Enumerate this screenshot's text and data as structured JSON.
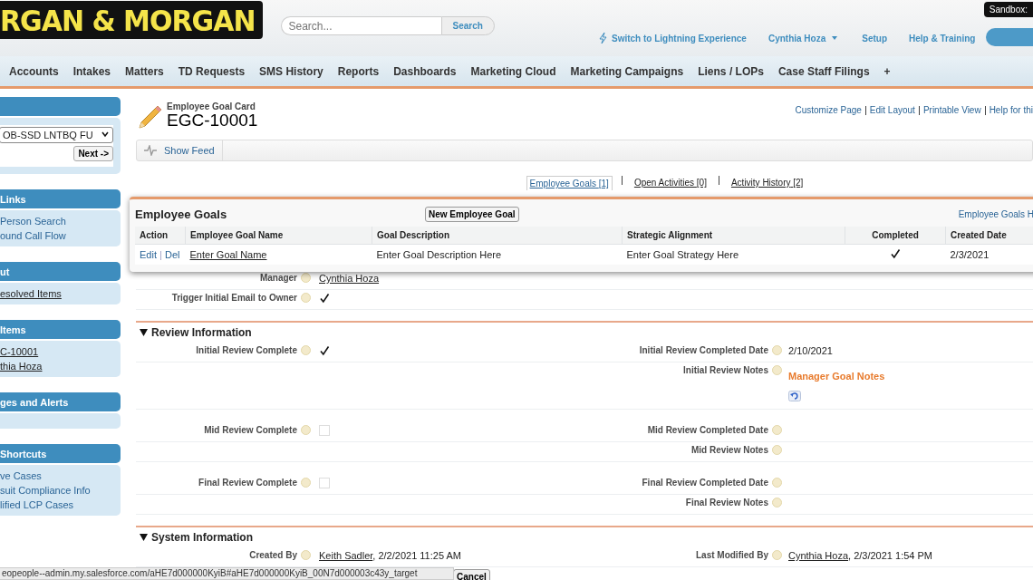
{
  "header": {
    "logo": "RGAN & MORGAN",
    "search_placeholder": "Search...",
    "search_button": "Search",
    "lightning_link": "Switch to Lightning Experience",
    "user_menu": "Cynthia Hoza",
    "links": [
      "Setup",
      "Help & Training"
    ],
    "sandbox_badge": "Sandbox:"
  },
  "nav_tabs": [
    "Accounts",
    "Intakes",
    "Matters",
    "TD Requests",
    "SMS History",
    "Reports",
    "Dashboards",
    "Marketing Cloud",
    "Marketing Campaigns",
    "Liens / LOPs",
    "Case Staff Filings",
    "+"
  ],
  "sidebar": [
    {
      "kind": "picker",
      "select_value": "OB-SSD LNTBQ FU",
      "button": "Next ->"
    },
    {
      "kind": "links",
      "title": "Links",
      "items": [
        "Person Search",
        "ound Call Flow"
      ]
    },
    {
      "kind": "recent",
      "title": "ut",
      "items": [
        "esolved Items"
      ]
    },
    {
      "kind": "recent",
      "title": "Items",
      "items": [
        "C-10001",
        "thia Hoza"
      ]
    },
    {
      "kind": "links",
      "title": "ges and Alerts"
    },
    {
      "kind": "links",
      "title": "Shortcuts",
      "items": [
        "ve Cases",
        "suit Compliance Info",
        "lified LCP Cases"
      ]
    }
  ],
  "record": {
    "type": "Employee Goal Card",
    "name": "EGC-10001",
    "links": [
      "Customize Page",
      "Edit Layout",
      "Printable View",
      "Help for thi"
    ]
  },
  "show_feed": "Show Feed",
  "related_tabs": [
    {
      "label": "Employee Goals",
      "count": "[1]",
      "selected": true
    },
    {
      "label": "Open Activities",
      "count": "[0]",
      "selected": false
    },
    {
      "label": "Activity History",
      "count": "[2]",
      "selected": false
    }
  ],
  "popup": {
    "title": "Employee Goals",
    "new_button": "New Employee Goal",
    "help_link": "Employee Goals H",
    "columns": [
      "Action",
      "Employee Goal Name",
      "Goal Description",
      "Strategic Alignment",
      "Completed",
      "Created Date"
    ],
    "rows": [
      {
        "actions": [
          "Edit",
          "Del"
        ],
        "name": "Enter Goal Name",
        "description": "Enter Goal Description Here",
        "strategy": "Enter Goal Strategy Here",
        "completed": true,
        "created": "2/3/2021"
      }
    ]
  },
  "top_fields": [
    {
      "label": "Manager",
      "kind": "link",
      "value": "Cynthia Hoza"
    },
    {
      "label": "Trigger Initial Email to Owner",
      "kind": "check",
      "checked": true
    }
  ],
  "sections": [
    {
      "title": "Review Information",
      "expanded": true,
      "groups": [
        [
          {
            "left": {
              "label": "Initial Review Complete",
              "kind": "check",
              "checked": true
            },
            "right": {
              "label": "Initial Review Completed Date",
              "kind": "text",
              "value": "2/10/2021"
            }
          },
          {
            "right": {
              "label": "Initial Review Notes",
              "kind": "notes",
              "value": "Manager Goal Notes"
            }
          }
        ],
        [
          {
            "left": {
              "label": "Mid Review Complete",
              "kind": "check",
              "checked": false
            },
            "right": {
              "label": "Mid Review Completed Date",
              "kind": "text"
            }
          },
          {
            "right": {
              "label": "Mid Review Notes",
              "kind": "text"
            }
          }
        ],
        [
          {
            "left": {
              "label": "Final Review Complete",
              "kind": "check",
              "checked": false
            },
            "right": {
              "label": "Final Review Completed Date",
              "kind": "text"
            }
          },
          {
            "right": {
              "label": "Final Review Notes",
              "kind": "text"
            }
          }
        ]
      ]
    },
    {
      "title": "System Information",
      "expanded": true,
      "groups": [
        [
          {
            "left": {
              "label": "Created By",
              "kind": "user",
              "value": "Keith Sadler",
              "extra": ", 2/2/2021 11:25 AM"
            },
            "right": {
              "label": "Last Modified By",
              "kind": "user",
              "value": "Cynthia Hoza",
              "extra": ", 2/3/2021 1:54 PM"
            }
          }
        ]
      ]
    }
  ],
  "buttons": [
    "Cancel"
  ],
  "status_bar": "eopeople--admin.my.salesforce.com/aHE7d000000KyiB#aHE7d000000KyiB_00N7d000003c43y_target"
}
